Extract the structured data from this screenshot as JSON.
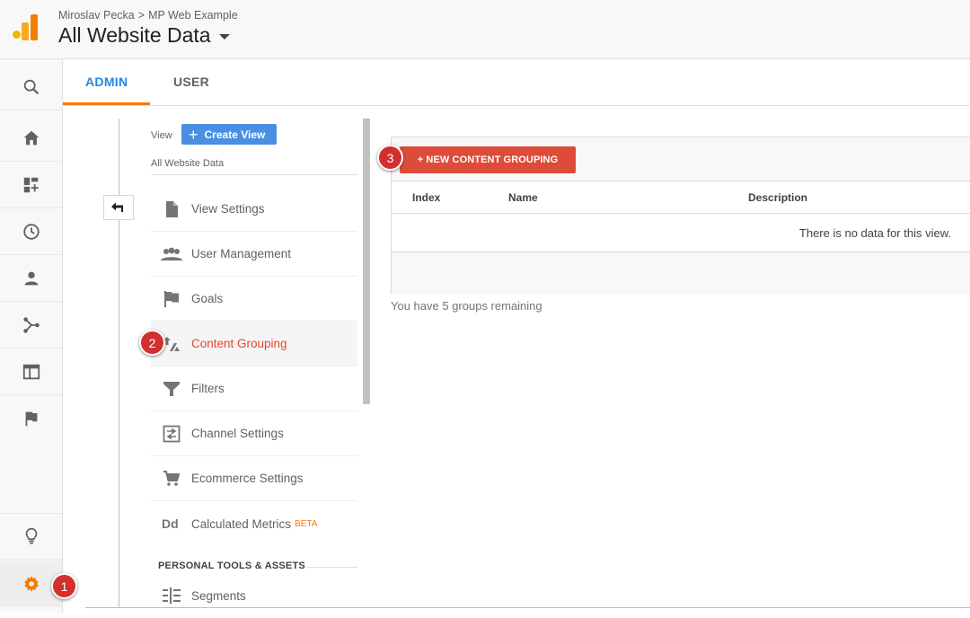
{
  "header": {
    "account": "Miroslav Pecka",
    "breadcrumb_sep": ">",
    "property": "MP Web Example",
    "view_title": "All Website Data"
  },
  "leftnav": {
    "items": [
      {
        "icon": "search-icon"
      },
      {
        "icon": "home-icon"
      },
      {
        "icon": "customization-icon"
      },
      {
        "icon": "realtime-clock-icon"
      },
      {
        "icon": "audience-person-icon"
      },
      {
        "icon": "acquisition-icon"
      },
      {
        "icon": "behavior-icon"
      },
      {
        "icon": "conversions-flag-icon"
      }
    ],
    "bottom": [
      {
        "icon": "lightbulb-icon"
      },
      {
        "icon": "admin-gear-icon",
        "color": "#f57c00"
      }
    ]
  },
  "tabs": [
    {
      "label": "ADMIN",
      "active": true
    },
    {
      "label": "USER",
      "active": false
    }
  ],
  "view_column": {
    "label": "View",
    "create_button": "Create View",
    "view_name": "All Website Data",
    "menu": [
      {
        "label": "View Settings",
        "icon": "document-icon"
      },
      {
        "label": "User Management",
        "icon": "people-icon"
      },
      {
        "label": "Goals",
        "icon": "flag-icon"
      },
      {
        "label": "Content Grouping",
        "icon": "content-grouping-icon",
        "selected": true
      },
      {
        "label": "Filters",
        "icon": "filter-icon"
      },
      {
        "label": "Channel Settings",
        "icon": "channel-settings-icon"
      },
      {
        "label": "Ecommerce Settings",
        "icon": "cart-icon"
      },
      {
        "label": "Calculated Metrics",
        "icon": "dd-icon",
        "badge": "BETA"
      }
    ],
    "section_heading": "PERSONAL TOOLS & ASSETS",
    "section_items": [
      {
        "label": "Segments",
        "icon": "segments-icon"
      }
    ]
  },
  "content": {
    "new_button": "+ NEW CONTENT GROUPING",
    "columns": [
      "Index",
      "Name",
      "Description"
    ],
    "empty_message": "There is no data for this view.",
    "remaining": "You have 5 groups remaining"
  },
  "markers": [
    "1",
    "2",
    "3"
  ],
  "colors": {
    "accent_blue": "#1e88e5",
    "accent_orange": "#f57c00",
    "button_red": "#dd4b39",
    "marker_red": "#d32f2f"
  }
}
